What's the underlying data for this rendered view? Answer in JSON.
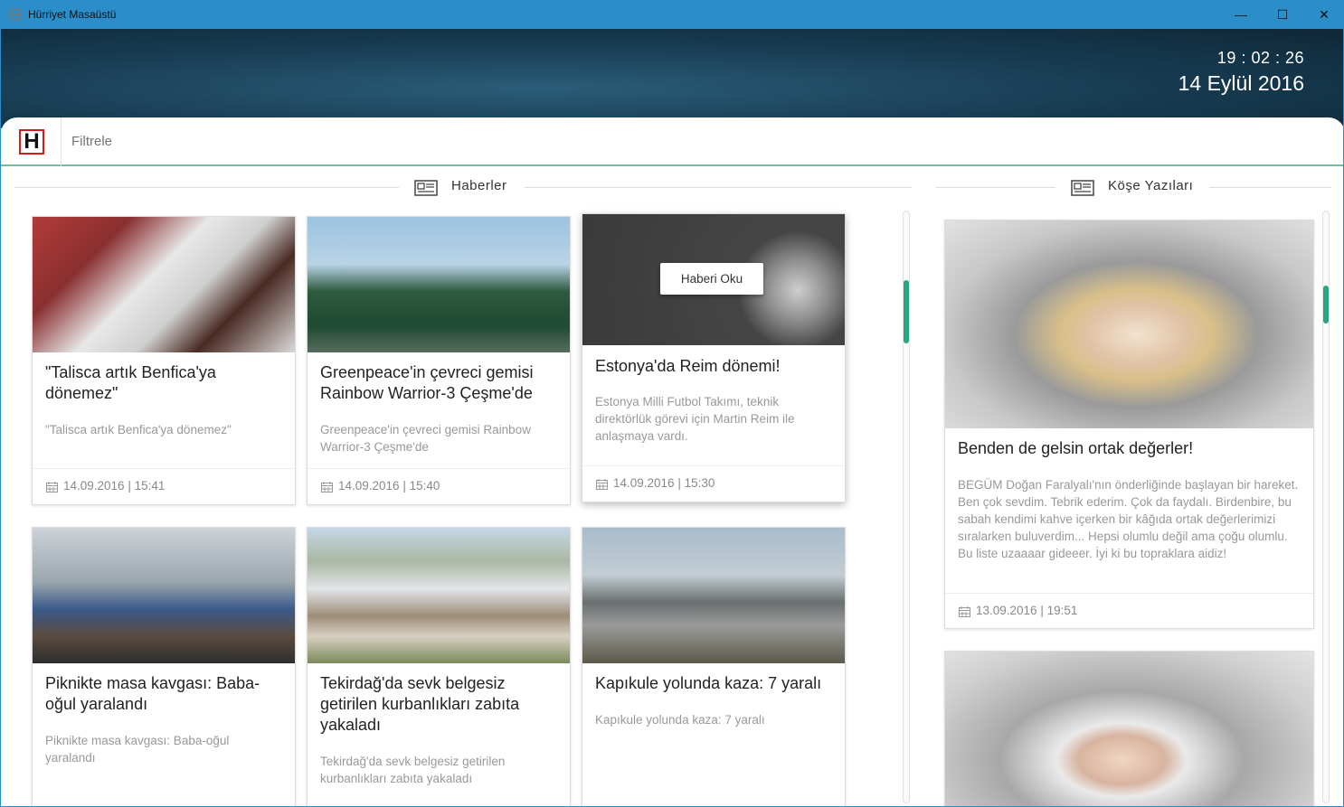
{
  "window": {
    "title": "Hürriyet Masaüstü",
    "minimize_glyph": "—",
    "maximize_glyph": "☐",
    "close_glyph": "✕"
  },
  "clock": {
    "time": "19 : 02 : 26",
    "date": "14 Eylül 2016"
  },
  "filter": {
    "placeholder": "Filtrele"
  },
  "brand": {
    "logo_letter": "H",
    "accent": "#d71920"
  },
  "sections": {
    "news": "Haberler",
    "columns": "Köşe Yazıları"
  },
  "news": [
    {
      "title": "\"Talisca artık Benfica'ya dönemez\"",
      "summary": "\"Talisca artık Benfica'ya dönemez\"",
      "date": "14.09.2016 | 15:41"
    },
    {
      "title": "Greenpeace'in çevreci gemisi Rainbow Warrior-3 Çeşme'de",
      "summary": "Greenpeace'in çevreci gemisi Rainbow Warrior-3 Çeşme'de",
      "date": "14.09.2016 | 15:40"
    },
    {
      "title": "Estonya'da Reim dönemi!",
      "summary": "Estonya Milli Futbol Takımı, teknik direktörlük görevi için Martin Reim ile anlaşmaya vardı.",
      "date": "14.09.2016 | 15:30",
      "button": "Haberi Oku"
    },
    {
      "title": "Piknikte masa kavgası: Baba-oğul yaralandı",
      "summary": "Piknikte masa kavgası: Baba-oğul yaralandı"
    },
    {
      "title": "Tekirdağ'da sevk belgesiz getirilen kurbanlıkları zabıta yakaladı",
      "summary": "Tekirdağ'da sevk belgesiz getirilen kurbanlıkları zabıta yakaladı"
    },
    {
      "title": "Kapıkule yolunda kaza: 7 yaralı",
      "summary": "Kapıkule yolunda kaza: 7 yaralı"
    }
  ],
  "columns": [
    {
      "title": "Benden de gelsin ortak değerler!",
      "summary": "BEGÜM Doğan Faralyalı'nın önderliğinde başlayan bir hareket. Ben çok sevdim. Tebrik ederim. Çok da faydalı. Birdenbire, bu sabah kendimi kahve içerken bir kâğıda ortak değerlerimizi sıralarken buluverdim... Hepsi olumlu değil ama çoğu olumlu. Bu liste uzaaaar gideeer. İyi ki bu topraklara aidiz!",
      "date": "13.09.2016 | 19:51"
    }
  ],
  "colors": {
    "titlebar": "#2b8ec9",
    "header": "#173a50",
    "scroll_thumb": "#2aa587"
  }
}
